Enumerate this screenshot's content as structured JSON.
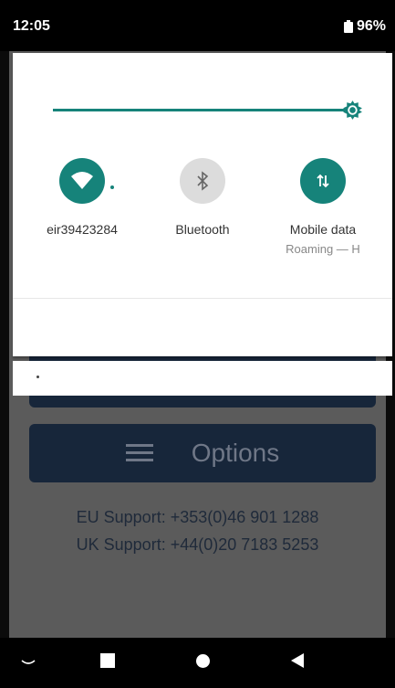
{
  "status_bar": {
    "time": "12:05",
    "battery": "96%"
  },
  "quick_settings": {
    "tiles": [
      {
        "label": "eir39423284",
        "sublabel": "",
        "icon": "wifi-icon"
      },
      {
        "label": "Bluetooth",
        "sublabel": "",
        "icon": "bluetooth-icon"
      },
      {
        "label": "Mobile data",
        "sublabel": "Roaming — H",
        "icon": "mobile-data-icon"
      }
    ]
  },
  "background_app": {
    "options_label": "Options",
    "eu_support": "EU Support: +353(0)46 901 1288",
    "uk_support": "UK Support: +44(0)20 7183 5253"
  },
  "colors": {
    "accent": "#16837a",
    "status_bar": "#000000",
    "button_bg": "#17263a"
  }
}
